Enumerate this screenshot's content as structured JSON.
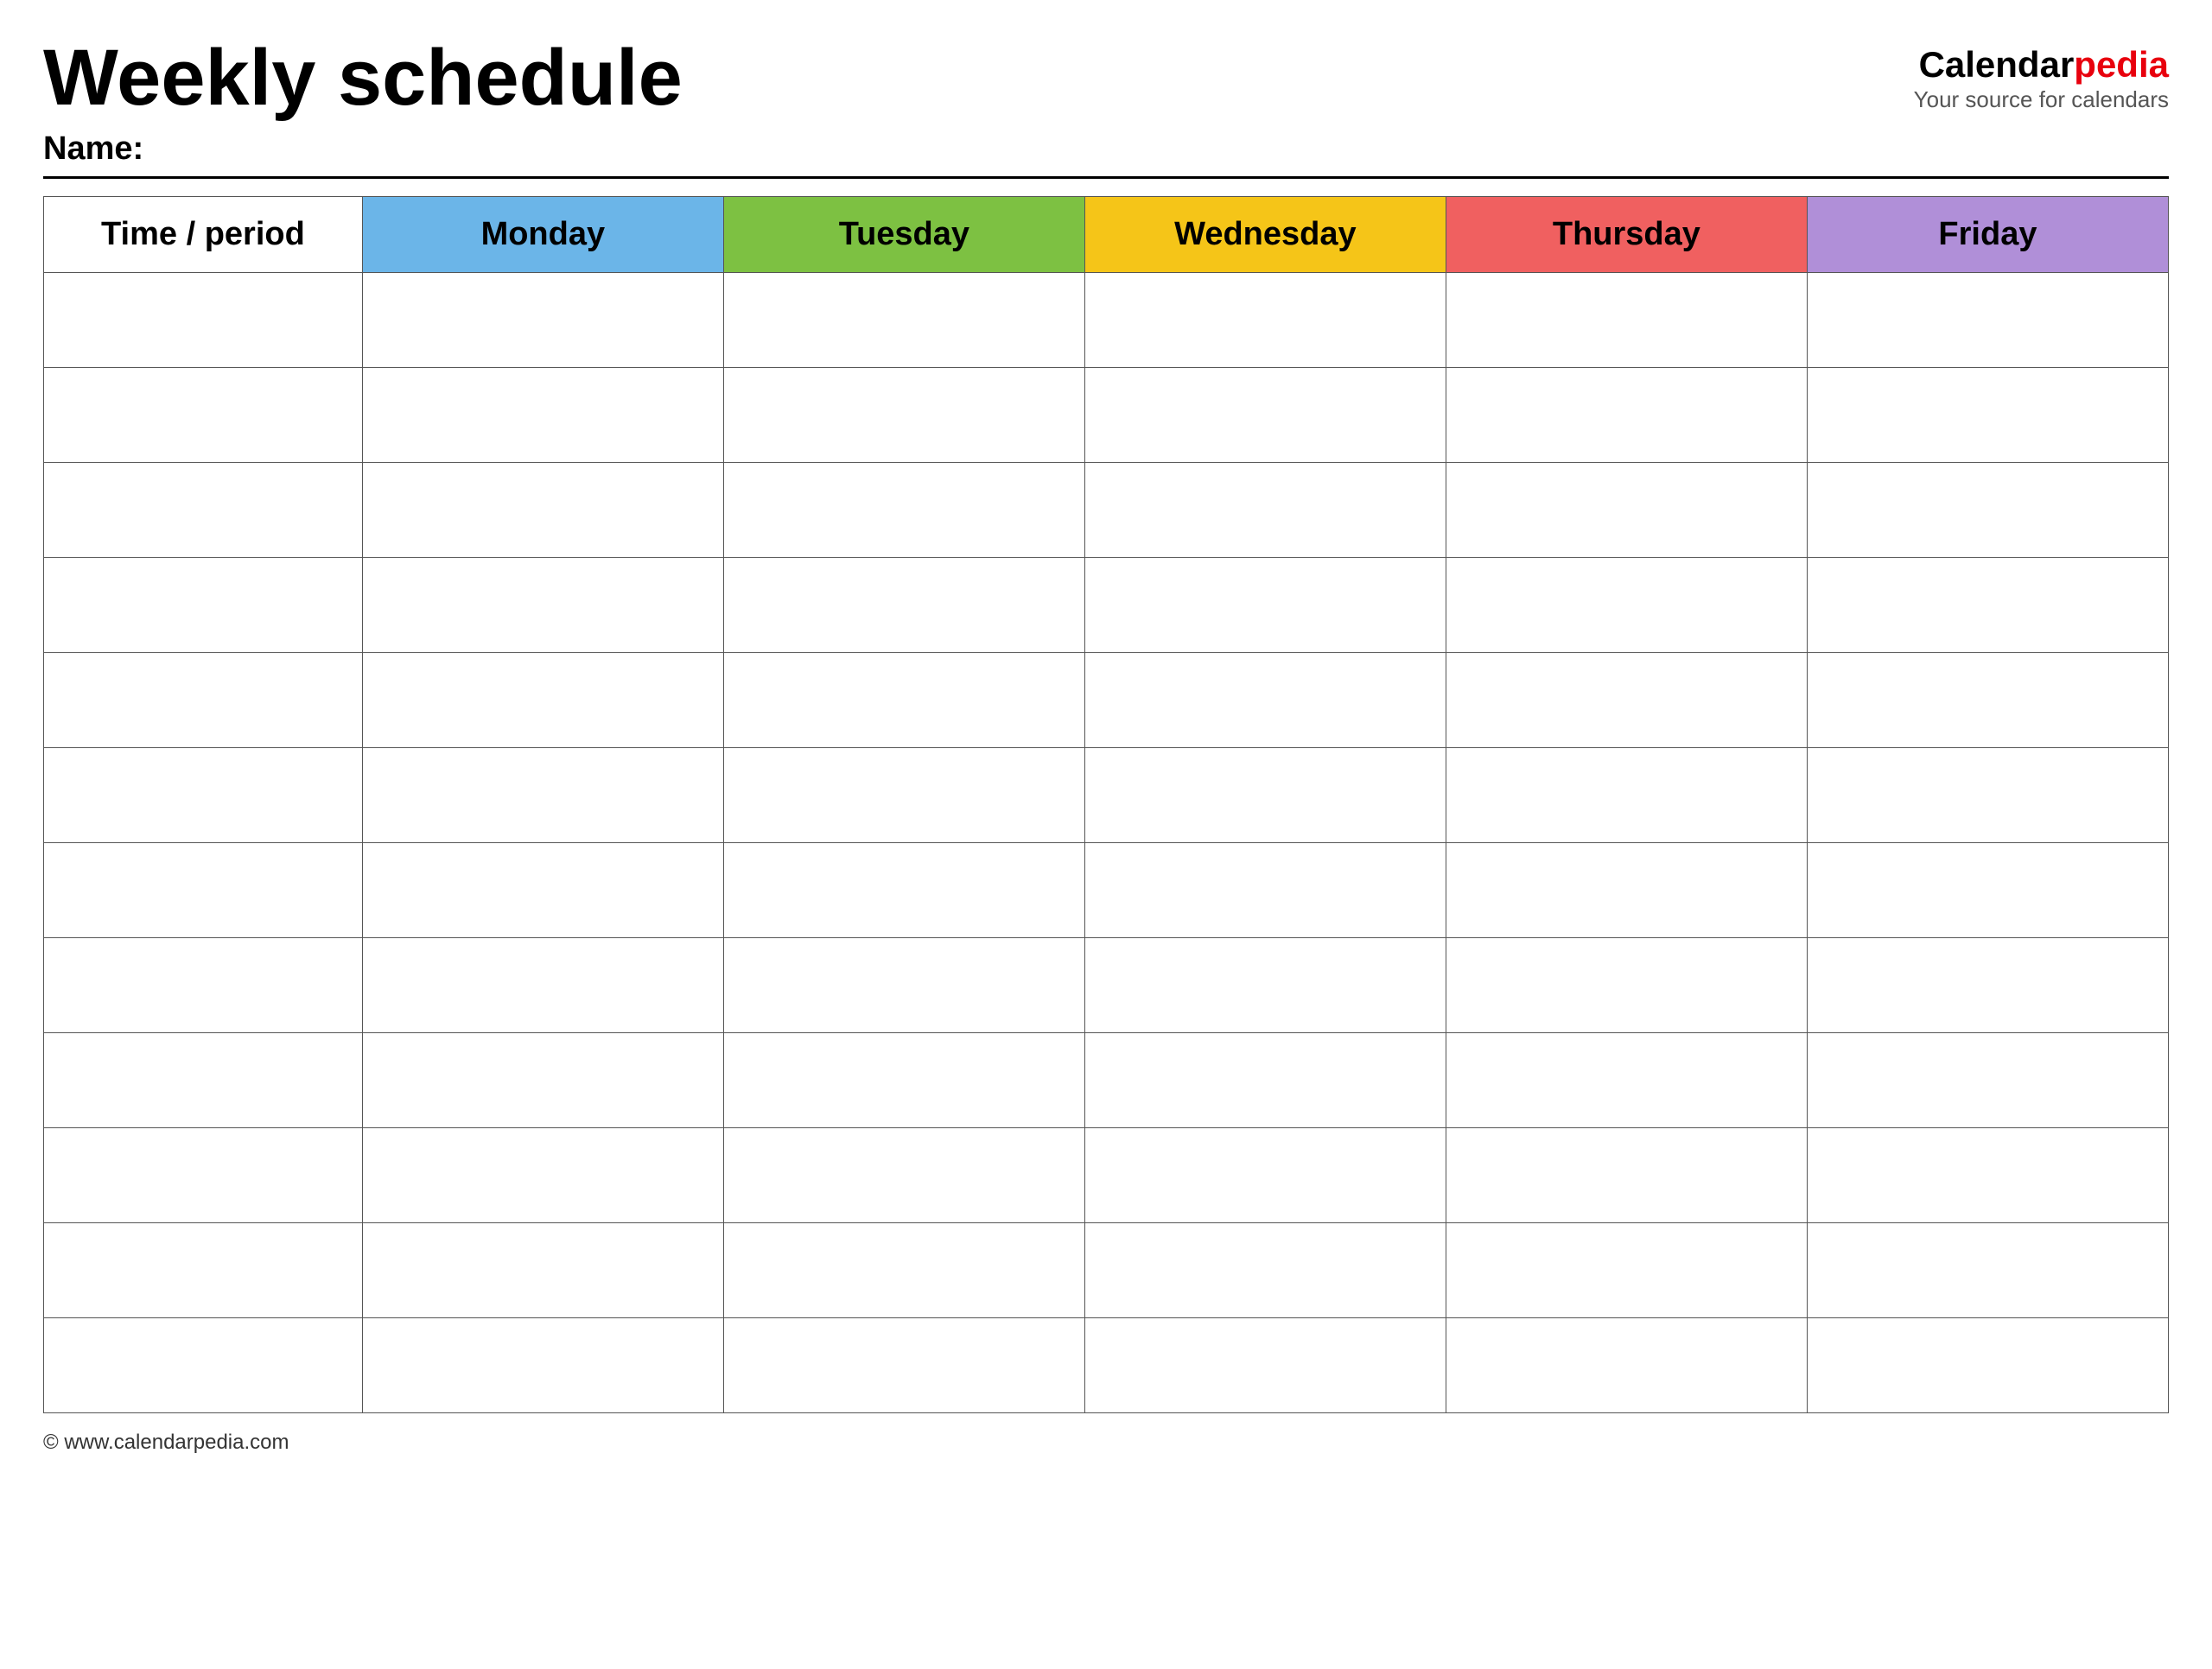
{
  "header": {
    "title": "Weekly schedule",
    "name_label": "Name:",
    "logo_calendar": "Calendar",
    "logo_pedia": "pedia",
    "logo_tagline": "Your source for calendars"
  },
  "table": {
    "columns": [
      {
        "key": "time",
        "label": "Time / period",
        "color": "#ffffff"
      },
      {
        "key": "monday",
        "label": "Monday",
        "color": "#6bb5e8"
      },
      {
        "key": "tuesday",
        "label": "Tuesday",
        "color": "#7dc142"
      },
      {
        "key": "wednesday",
        "label": "Wednesday",
        "color": "#f5c518"
      },
      {
        "key": "thursday",
        "label": "Thursday",
        "color": "#f06060"
      },
      {
        "key": "friday",
        "label": "Friday",
        "color": "#b08fd8"
      }
    ],
    "rows": 12
  },
  "footer": {
    "url": "© www.calendarpedia.com"
  }
}
